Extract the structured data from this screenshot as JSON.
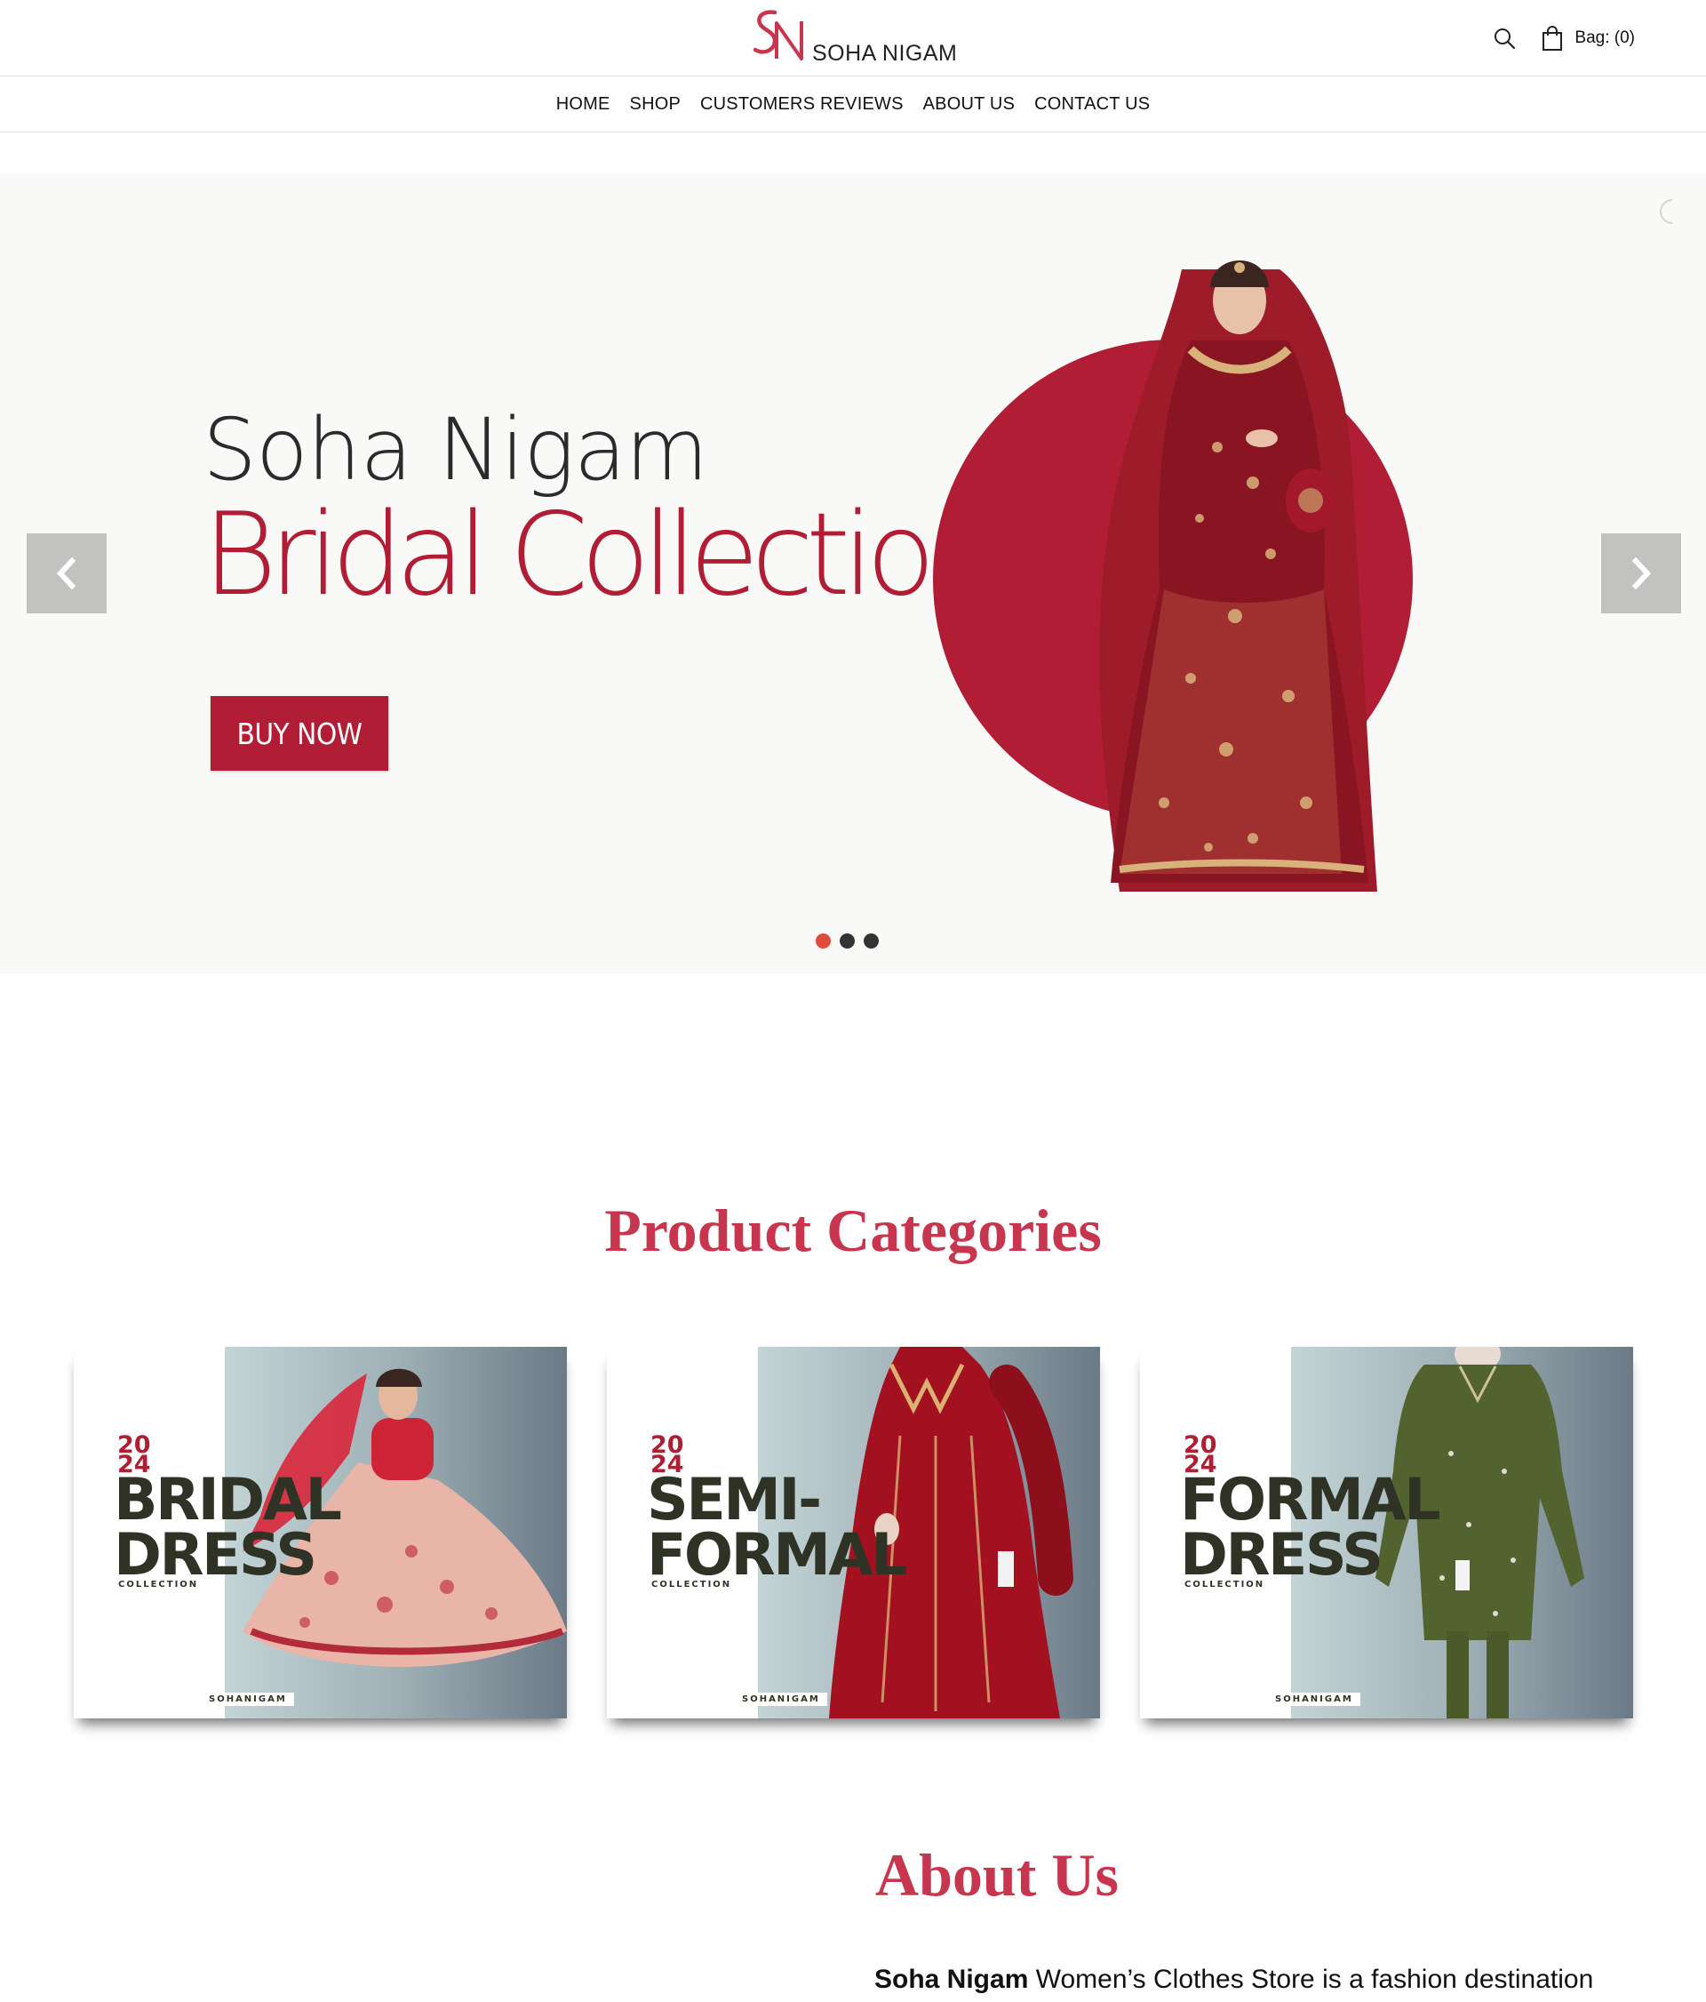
{
  "header": {
    "logo_text": "SOHA NIGAM",
    "search_icon": "search-icon",
    "bag_label": "Bag: (0)",
    "bag_icon": "shopping-bag-icon"
  },
  "nav": {
    "items": [
      {
        "label": "HOME"
      },
      {
        "label": "SHOP"
      },
      {
        "label": "CUSTOMERS REVIEWS"
      },
      {
        "label": "ABOUT US"
      },
      {
        "label": "CONTACT US"
      }
    ]
  },
  "hero": {
    "title_line1": "Soha Nigam",
    "title_line2": "Bridal Collection",
    "cta_label": "BUY NOW",
    "prev_icon": "chevron-left-icon",
    "next_icon": "chevron-right-icon",
    "slide_count": 3,
    "active_slide": 1,
    "accent_color": "#b11d35"
  },
  "categories": {
    "title": "Product Categories",
    "cards": [
      {
        "year_top": "20",
        "year_bottom": "24",
        "headline": "BRIDAL\nDRESS",
        "subtitle": "COLLECTION",
        "brand": "SOHANIGAM"
      },
      {
        "year_top": "20",
        "year_bottom": "24",
        "headline": "SEMI-\nFORMAL",
        "subtitle": "COLLECTION",
        "brand": "SOHANIGAM"
      },
      {
        "year_top": "20",
        "year_bottom": "24",
        "headline": "FORMAL\nDRESS",
        "subtitle": "COLLECTION",
        "brand": "SOHANIGAM"
      }
    ]
  },
  "about": {
    "title": "About Us",
    "brand_bold": "Soha Nigam",
    "text": " Women’s Clothes Store is a fashion destination"
  }
}
